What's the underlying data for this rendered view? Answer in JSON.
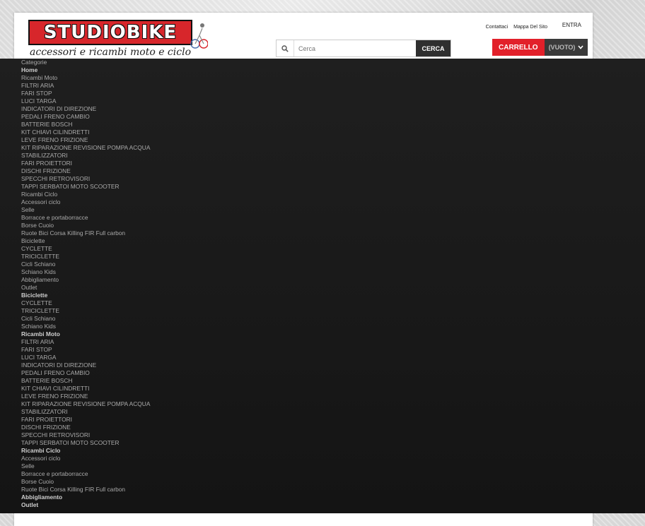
{
  "header": {
    "logo_text": "STUDIOBIKE",
    "logo_tagline": "accessori e ricambi moto e ciclo",
    "links": [
      "Contattaci",
      "Mappa Del Sito"
    ],
    "login": "ENTRA"
  },
  "search": {
    "placeholder": "Cerca",
    "button": "CERCA"
  },
  "cart": {
    "label": "CARRELLO",
    "status": "(VUOTO)"
  },
  "categories": [
    {
      "label": "Categorie",
      "bold": false
    },
    {
      "label": "Home",
      "bold": true
    },
    {
      "label": "Ricambi Moto",
      "bold": false
    },
    {
      "label": "FILTRI ARIA",
      "bold": false
    },
    {
      "label": "FARI STOP",
      "bold": false
    },
    {
      "label": "LUCI TARGA",
      "bold": false
    },
    {
      "label": "INDICATORI DI DIREZIONE",
      "bold": false
    },
    {
      "label": "PEDALI FRENO CAMBIO",
      "bold": false
    },
    {
      "label": "BATTERIE BOSCH",
      "bold": false
    },
    {
      "label": "KIT CHIAVI CILINDRETTI",
      "bold": false
    },
    {
      "label": "LEVE FRENO FRIZIONE",
      "bold": false
    },
    {
      "label": "KIT RIPARAZIONE REVISIONE POMPA ACQUA",
      "bold": false
    },
    {
      "label": "STABILIZZATORI",
      "bold": false
    },
    {
      "label": "FARI PROIETTORI",
      "bold": false
    },
    {
      "label": "DISCHI FRIZIONE",
      "bold": false
    },
    {
      "label": "SPECCHI RETROVISORI",
      "bold": false
    },
    {
      "label": "TAPPI SERBATOI MOTO SCOOTER",
      "bold": false
    },
    {
      "label": "Ricambi Ciclo",
      "bold": false
    },
    {
      "label": "Accessori ciclo",
      "bold": false
    },
    {
      "label": "Selle",
      "bold": false
    },
    {
      "label": "Borracce e portaborracce",
      "bold": false
    },
    {
      "label": "Borse Cuoio",
      "bold": false
    },
    {
      "label": "Ruote Bici Corsa Killing FIR Full carbon",
      "bold": false
    },
    {
      "label": "Biciclette",
      "bold": false
    },
    {
      "label": "CYCLETTE",
      "bold": false
    },
    {
      "label": "TRICICLETTE",
      "bold": false
    },
    {
      "label": "Cicli Schiano",
      "bold": false
    },
    {
      "label": "Schiano Kids",
      "bold": false
    },
    {
      "label": "Abbigliamento",
      "bold": false
    },
    {
      "label": "Outlet",
      "bold": false
    },
    {
      "label": "Biciclette",
      "bold": true
    },
    {
      "label": "CYCLETTE",
      "bold": false
    },
    {
      "label": "TRICICLETTE",
      "bold": false
    },
    {
      "label": "Cicli Schiano",
      "bold": false
    },
    {
      "label": "Schiano Kids",
      "bold": false
    },
    {
      "label": "Ricambi Moto",
      "bold": true
    },
    {
      "label": "FILTRI ARIA",
      "bold": false
    },
    {
      "label": "FARI STOP",
      "bold": false
    },
    {
      "label": "LUCI TARGA",
      "bold": false
    },
    {
      "label": "INDICATORI DI DIREZIONE",
      "bold": false
    },
    {
      "label": "PEDALI FRENO CAMBIO",
      "bold": false
    },
    {
      "label": "BATTERIE BOSCH",
      "bold": false
    },
    {
      "label": "KIT CHIAVI CILINDRETTI",
      "bold": false
    },
    {
      "label": "LEVE FRENO FRIZIONE",
      "bold": false
    },
    {
      "label": "KIT RIPARAZIONE REVISIONE POMPA ACQUA",
      "bold": false
    },
    {
      "label": "STABILIZZATORI",
      "bold": false
    },
    {
      "label": "FARI PROIETTORI",
      "bold": false
    },
    {
      "label": "DISCHI FRIZIONE",
      "bold": false
    },
    {
      "label": "SPECCHI RETROVISORI",
      "bold": false
    },
    {
      "label": "TAPPI SERBATOI MOTO SCOOTER",
      "bold": false
    },
    {
      "label": "Ricambi Ciclo",
      "bold": true
    },
    {
      "label": "Accessori ciclo",
      "bold": false
    },
    {
      "label": "Selle",
      "bold": false
    },
    {
      "label": "Borracce e portaborracce",
      "bold": false
    },
    {
      "label": "Borse Cuoio",
      "bold": false
    },
    {
      "label": "Ruote Bici Corsa Killing FIR Full carbon",
      "bold": false
    },
    {
      "label": "Abbigliamento",
      "bold": true
    },
    {
      "label": "Outlet",
      "bold": true
    }
  ]
}
